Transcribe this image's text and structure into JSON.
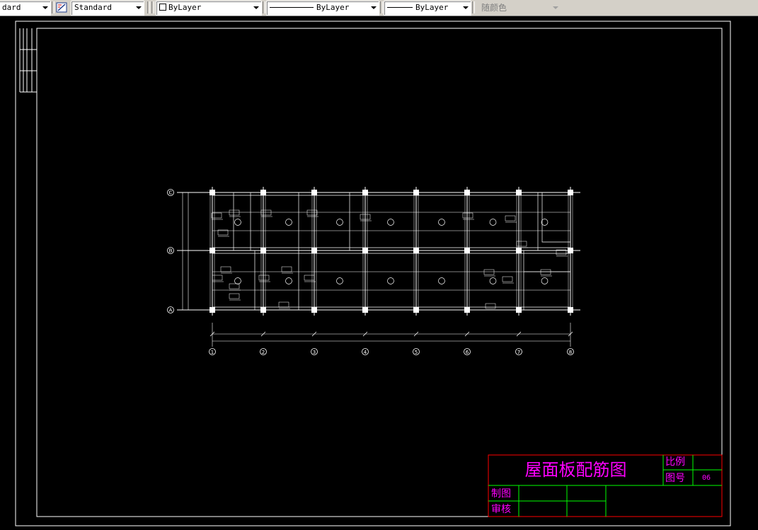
{
  "toolbar": {
    "text_style": "dard",
    "dim_style": "Standard",
    "layer_color": "ByLayer",
    "linetype": "ByLayer",
    "lineweight": "ByLayer",
    "plot_style": "随颜色"
  },
  "drawing": {
    "grid_rows": [
      "C",
      "B",
      "A"
    ],
    "grid_cols": [
      "1",
      "2",
      "3",
      "4",
      "5",
      "6",
      "7",
      "8"
    ],
    "title_block": {
      "title": "屋面板配筋图",
      "scale_label": "比例",
      "drawing_no_label": "图号",
      "drawing_no": "06",
      "drawn_label": "制图",
      "checked_label": "审核"
    }
  },
  "colors": {
    "background": "#000000",
    "lines": "#ffffff",
    "title_text": "#ff00ff",
    "title_block_border": "#ff0000",
    "title_block_grid": "#00ff00"
  }
}
